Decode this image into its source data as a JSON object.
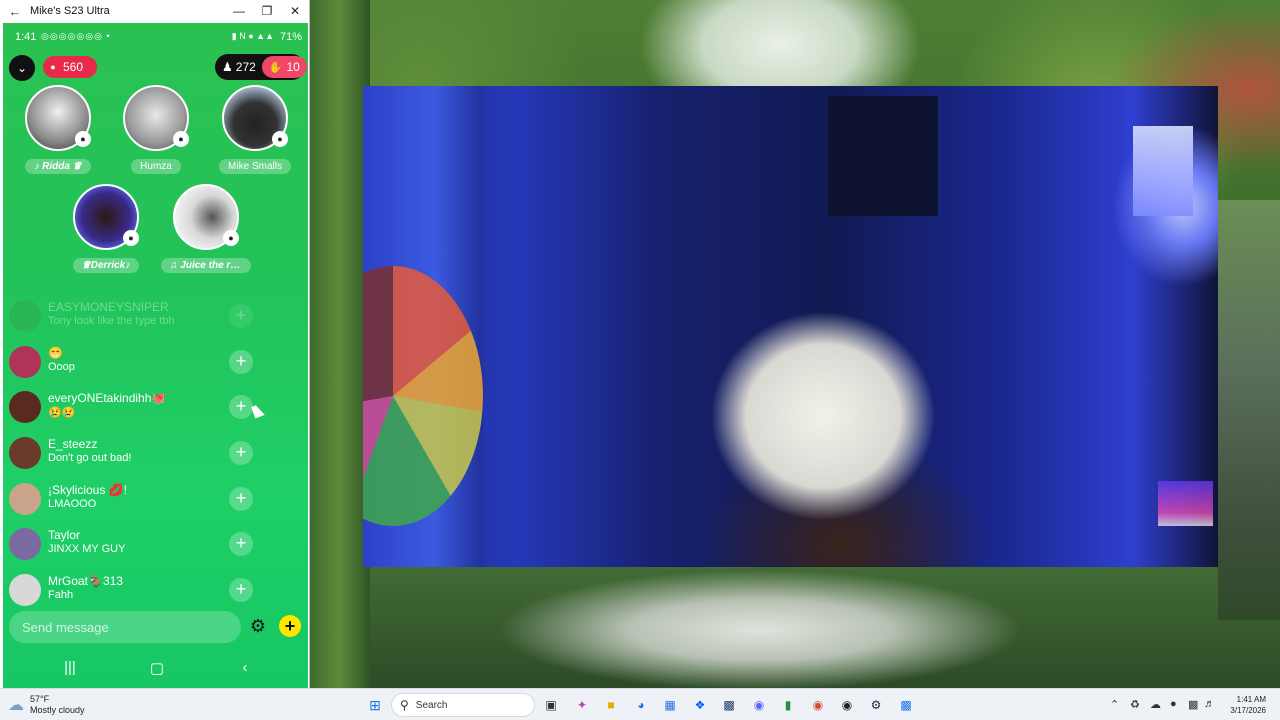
{
  "window": {
    "title": "Mike's S23 Ultra"
  },
  "status_bar": {
    "time": "1:41",
    "battery": "71%"
  },
  "stream": {
    "coins": "560",
    "viewers": "272",
    "likes": "10"
  },
  "guests": [
    {
      "name": "♪ Ridda ♛"
    },
    {
      "name": "Humza"
    },
    {
      "name": "Mike Smalls"
    },
    {
      "name": "♛Derrick♪"
    },
    {
      "name": "♫ Juice the rippe..."
    }
  ],
  "chat": [
    {
      "user": "EASYMONEYSNIPER",
      "message": "Tony look like the type tbh",
      "avatar_color": "#3a9a4a"
    },
    {
      "user": "😁",
      "message": "Ooop",
      "avatar_color": "#b0335a"
    },
    {
      "user": "everyONEtakindihh🐙",
      "message": "😢😢",
      "avatar_color": "#5a2a1e"
    },
    {
      "user": "E_steezz",
      "message": "Don't go out bad!",
      "avatar_color": "#6a3a2a"
    },
    {
      "user": "¡Skylicious 💋!",
      "message": "LMAOOO",
      "avatar_color": "#c9a48a"
    },
    {
      "user": "Taylor",
      "message": "JINXX MY GUY",
      "avatar_color": "#7a6aa0"
    },
    {
      "user": "MrGoat🐐313",
      "message": "Fahh",
      "avatar_color": "#d8d8d8"
    }
  ],
  "composer": {
    "placeholder": "Send message"
  },
  "taskbar": {
    "weather_temp": "57°F",
    "weather_desc": "Mostly cloudy",
    "search_label": "Search",
    "clock_time": "1:41 AM",
    "clock_date": "3/17/2026"
  },
  "colors": {
    "live_green": "#22c35a",
    "coin_red": "#e8294a",
    "add_yellow": "#ffe600"
  }
}
